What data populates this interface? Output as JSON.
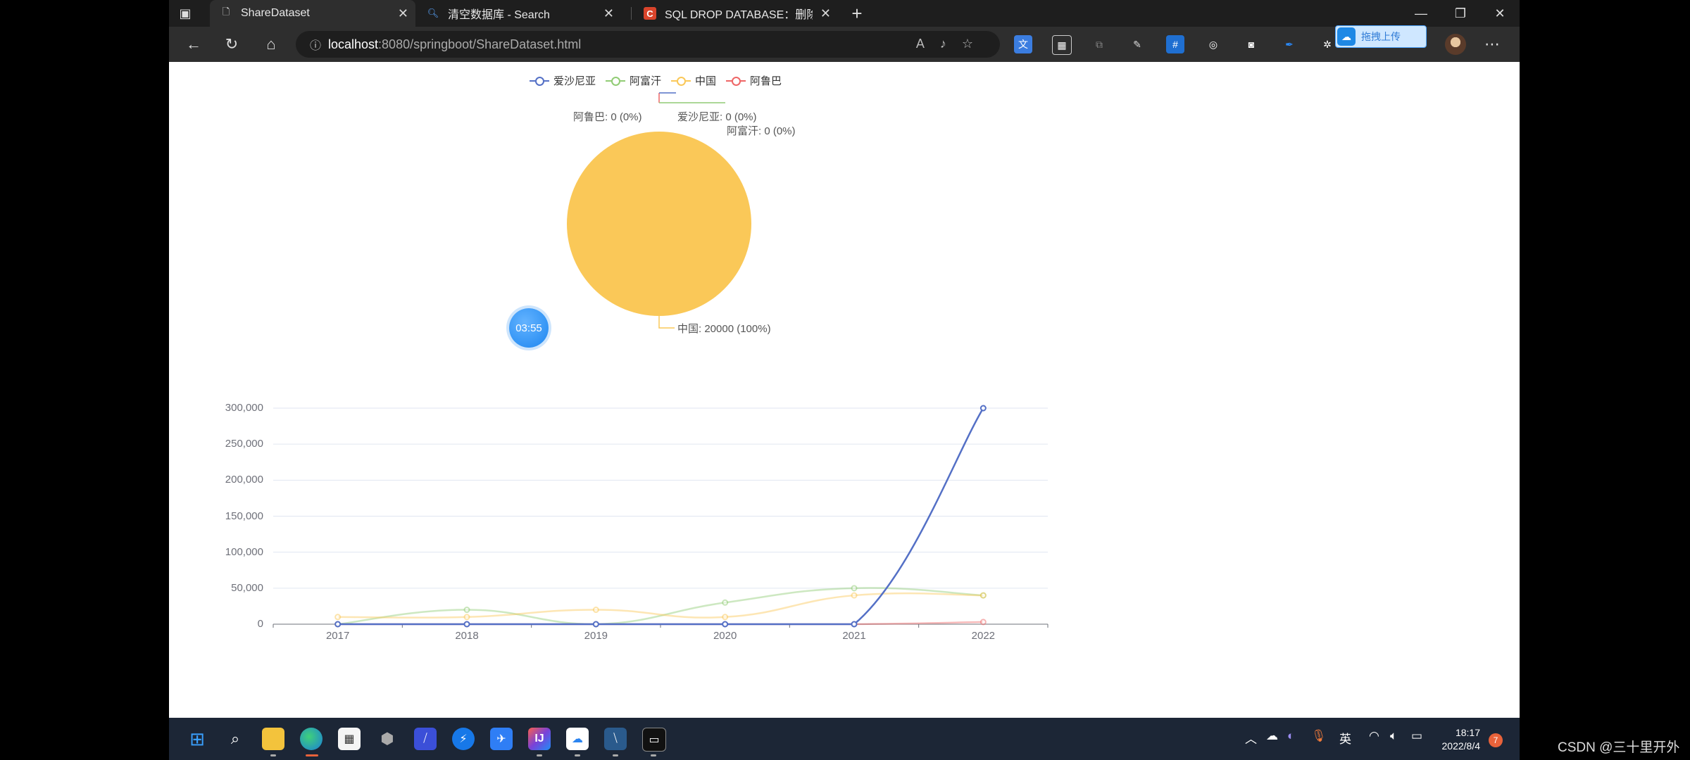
{
  "browser": {
    "tabs": [
      {
        "title": "ShareDataset",
        "active": true
      },
      {
        "title": "清空数据库 - Search",
        "active": false
      },
      {
        "title": "SQL DROP DATABASE：删除数据",
        "active": false
      }
    ],
    "new_tab_label": "+",
    "url_host": "localhost",
    "url_rest": ":8080/springboot/ShareDataset.html",
    "upload_label": "拖拽上传",
    "window_controls": [
      "minimize",
      "restore",
      "close"
    ]
  },
  "page": {
    "legend": [
      "爱沙尼亚",
      "阿富汗",
      "中国",
      "阿鲁巴"
    ],
    "pie_labels": {
      "aruba": "阿鲁巴: 0 (0%)",
      "estonia": "爱沙尼亚: 0 (0%)",
      "afghanistan": "阿富汗: 0 (0%)",
      "china": "中国: 20000 (100%)"
    },
    "timer": "03:55"
  },
  "chart_data": [
    {
      "type": "pie",
      "title": "",
      "slices": [
        {
          "name": "爱沙尼亚",
          "value": 0,
          "percent": 0
        },
        {
          "name": "阿富汗",
          "value": 0,
          "percent": 0
        },
        {
          "name": "中国",
          "value": 20000,
          "percent": 100
        },
        {
          "name": "阿鲁巴",
          "value": 0,
          "percent": 0
        }
      ],
      "colors": [
        "#5470c6",
        "#91cc75",
        "#fac858",
        "#ee6666"
      ]
    },
    {
      "type": "line",
      "title": "",
      "x": [
        "2017",
        "2018",
        "2019",
        "2020",
        "2021",
        "2022"
      ],
      "ylim": [
        0,
        300000
      ],
      "yticks": [
        "0",
        "50,000",
        "100,000",
        "150,000",
        "200,000",
        "250,000",
        "300,000"
      ],
      "smooth": true,
      "grid": true,
      "series": [
        {
          "name": "爱沙尼亚",
          "color": "#5470c6",
          "values": [
            0,
            0,
            0,
            0,
            0,
            300000
          ]
        },
        {
          "name": "阿富汗",
          "color": "#91cc75",
          "values": [
            0,
            20000,
            0,
            30000,
            50000,
            40000
          ]
        },
        {
          "name": "中国",
          "color": "#fac858",
          "values": [
            10000,
            10000,
            20000,
            10000,
            40000,
            40000
          ]
        },
        {
          "name": "阿鲁巴",
          "color": "#ee6666",
          "values": [
            0,
            0,
            0,
            0,
            0,
            3000
          ]
        }
      ]
    }
  ],
  "taskbar": {
    "apps": [
      "windows-start-icon",
      "search-icon",
      "file-explorer-icon",
      "edge-icon",
      "store-icon",
      "vmware-icon",
      "typora-icon",
      "thunder-icon",
      "feishu-icon",
      "intellij-icon",
      "baidu-netdisk-icon",
      "xshell-icon",
      "terminal-icon"
    ],
    "ime": "英",
    "time": "18:17",
    "date": "2022/8/4",
    "notifications": "7"
  },
  "watermark": "CSDN @三十里开外"
}
